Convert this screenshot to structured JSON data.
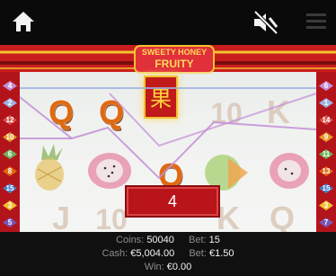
{
  "top_bar": {
    "home_icon": "home-icon",
    "mute_icon": "speaker-muted-icon",
    "menu_icon": "hamburger-menu-icon"
  },
  "game": {
    "logo": {
      "line1": "SWEETY HONEY",
      "line2": "FRUITY"
    },
    "wild_symbol": "果",
    "win_amount": "4",
    "left_paylines": [
      "4",
      "2",
      "12",
      "10",
      "6",
      "8",
      "15",
      "3",
      "5"
    ],
    "right_paylines": [
      "6",
      "1",
      "14",
      "9",
      "11",
      "13",
      "15",
      "3",
      "7"
    ],
    "reels": [
      [
        "Q",
        "J"
      ],
      [
        "Q",
        "10"
      ],
      [
        "Q",
        "K"
      ],
      [
        "10",
        "K"
      ],
      [
        "K",
        "Q"
      ]
    ]
  },
  "status": {
    "coins_label": "Coins:",
    "coins_value": "50040",
    "bet_coins_label": "Bet:",
    "bet_coins_value": "15",
    "cash_label": "Cash:",
    "cash_value": "€5,004.00",
    "bet_label": "Bet:",
    "bet_value": "€1.50",
    "win_label": "Win:",
    "win_value": "€0.00"
  },
  "colors": {
    "frame_red": "#b3141b",
    "gold": "#f1c232",
    "letter_orange": "#e06a12",
    "payline_purple": "#b07fc9",
    "payline_blue": "#8fa6d6"
  }
}
